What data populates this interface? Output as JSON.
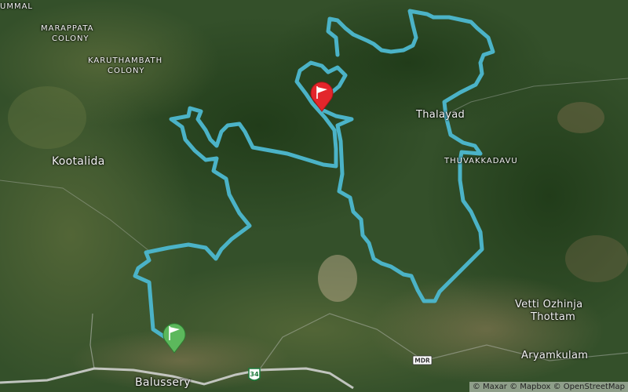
{
  "map": {
    "labels": {
      "ummal": "UMMAL",
      "marappata": "MARAPPATA",
      "colony1": "COLONY",
      "karuthambath": "KARUTHAMBATH",
      "colony2": "COLONY",
      "kootalida": "Kootalida",
      "thalayad": "Thalayad",
      "thuvakkadavu": "THUVAKKADAVU",
      "vetti": "Vetti Ozhinja",
      "thottam": "Thottam",
      "aryamkulam": "Aryamkulam",
      "balussery": "Balussery"
    },
    "road_shields": {
      "r34": "34",
      "mdr": "MDR"
    },
    "markers": {
      "start": {
        "color": "#5cb85c",
        "icon": "flag-icon"
      },
      "finish": {
        "color": "#e3262b",
        "icon": "flag-icon"
      }
    },
    "route_color": "#4bb3c7",
    "attribution": "© Maxar © Mapbox © OpenStreetMap"
  }
}
